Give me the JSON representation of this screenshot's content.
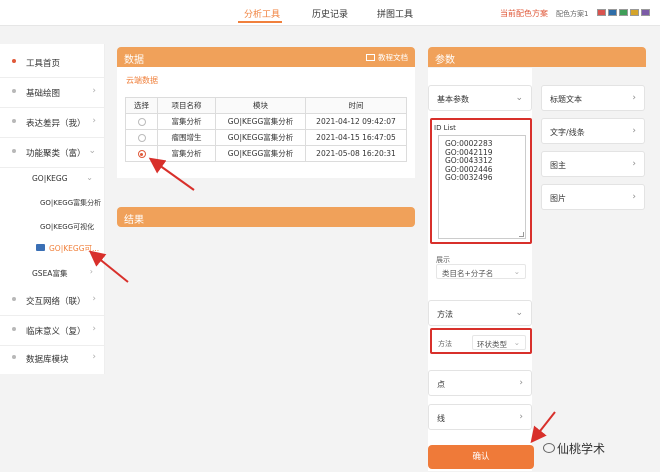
{
  "nav": {
    "tabs": [
      {
        "label": "分析工具",
        "active": true
      },
      {
        "label": "历史记录",
        "active": false
      },
      {
        "label": "拼图工具",
        "active": false
      }
    ],
    "color_scheme_link": "当前配色方案",
    "color_scheme_label": "配色方案1",
    "swatches": [
      "#d9534f",
      "#2f6ea8",
      "#3f9e58",
      "#d4a42a",
      "#7b5aa6"
    ]
  },
  "sidebar": {
    "items": [
      {
        "label": "工具首页",
        "chev": ""
      },
      {
        "label": "基础绘图",
        "chev": "›"
      },
      {
        "label": "表达差异（我）",
        "chev": "›"
      },
      {
        "label": "功能聚类（富）",
        "chev": "⌄"
      }
    ],
    "sub_group": {
      "label": "GO|KEGG",
      "chev": "⌄"
    },
    "sub_items": [
      {
        "label": "GO|KEGG富集分析"
      },
      {
        "label": "GO|KEGG可视化"
      }
    ],
    "active_sub": "GO|KEGG可...",
    "gsea": {
      "label": "GSEA富集",
      "chev": "›"
    },
    "more_items": [
      {
        "label": "交互网络（联）",
        "chev": "›"
      },
      {
        "label": "临床意义（复）",
        "chev": "›"
      },
      {
        "label": "数据库模块",
        "chev": "›"
      }
    ]
  },
  "data_panel": {
    "title": "数据",
    "doc_link": "教程文档",
    "cloud_label": "云端数据",
    "table": {
      "headers": [
        "选择",
        "项目名称",
        "模块",
        "时间"
      ],
      "rows": [
        {
          "selected": false,
          "name": "富集分析",
          "module": "GO|KEGG富集分析",
          "time": "2021-04-12 09:42:07"
        },
        {
          "selected": false,
          "name": "瘤围增生",
          "module": "GO|KEGG富集分析",
          "time": "2021-04-15 16:47:05"
        },
        {
          "selected": true,
          "name": "富集分析",
          "module": "GO|KEGG富集分析",
          "time": "2021-05-08 16:20:31"
        }
      ]
    }
  },
  "result_panel": {
    "title": "结果"
  },
  "params": {
    "title": "参数",
    "basic": {
      "label": "基本参数",
      "chev": "⌄"
    },
    "id_list_label": "ID List",
    "id_list_value": "GO:0002283\nGO:0042119\nGO:0043312\nGO:0002446\nGO:0032496",
    "show_label": "展示",
    "show_value": "类目名+分子名",
    "method": {
      "label": "方法",
      "chev": "⌄"
    },
    "method_field_label": "方法",
    "method_field_value": "环状类型",
    "point": {
      "label": "点",
      "chev": "›"
    },
    "line": {
      "label": "线",
      "chev": "›"
    },
    "confirm": "确认"
  },
  "right_col": {
    "items": [
      {
        "label": "标题文本",
        "chev": "›"
      },
      {
        "label": "文字/线条",
        "chev": "›"
      },
      {
        "label": "图主",
        "chev": "›"
      },
      {
        "label": "图片",
        "chev": "›"
      }
    ]
  },
  "watermark": "仙桃学术"
}
